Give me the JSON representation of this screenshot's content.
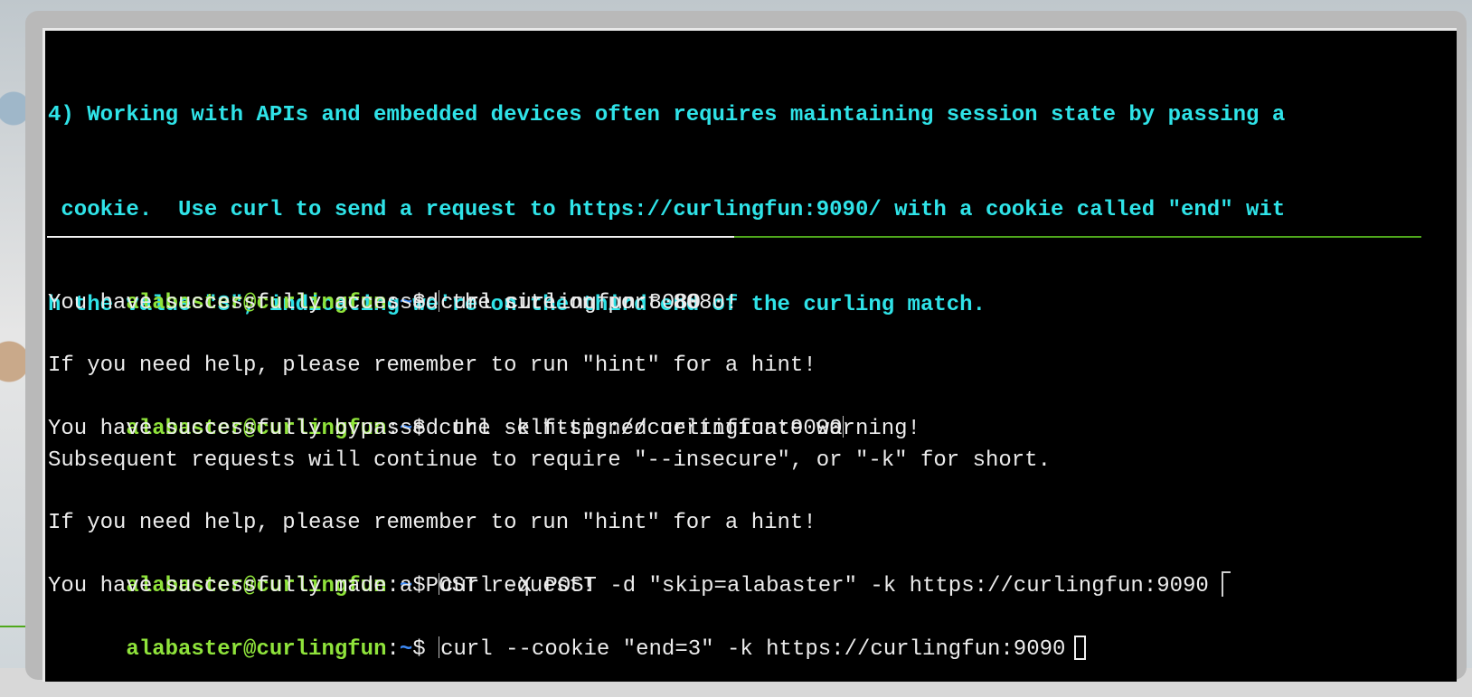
{
  "objective": {
    "lines": [
      "4) Working with APIs and embedded devices often requires maintaining session state by passing a",
      " cookie.  Use curl to send a request to https://curlingfun:9090/ with a cookie called \"end\" wit",
      "h the value \"3\", indicating we're on the third end of the curling match."
    ]
  },
  "prompt": {
    "user_host": "alabaster@curlingfun",
    "separator": ":",
    "path": "~",
    "symbol": "$ "
  },
  "terminal": {
    "lines": [
      {
        "type": "prompt",
        "command": "curl curlingfun:8080"
      },
      {
        "type": "output",
        "text": "You have successfully accessed the site on port 8080!"
      },
      {
        "type": "output",
        "text": ""
      },
      {
        "type": "output",
        "text": "If you need help, please remember to run \"hint\" for a hint!"
      },
      {
        "type": "prompt",
        "command": "curl -k https://curlingfun:9090"
      },
      {
        "type": "output",
        "text": "You have successfully bypassed the self-signed certificate warning!"
      },
      {
        "type": "output",
        "text": "Subsequent requests will continue to require \"--insecure\", or \"-k\" for short."
      },
      {
        "type": "output",
        "text": ""
      },
      {
        "type": "output",
        "text": "If you need help, please remember to run \"hint\" for a hint!"
      },
      {
        "type": "prompt",
        "command": "curl -X POST -d \"skip=alabaster\" -k https://curlingfun:9090"
      },
      {
        "type": "output",
        "text": "You have successfully made a POST request!"
      },
      {
        "type": "prompt",
        "command": "curl --cookie \"end=3\" -k https://curlingfun:9090"
      }
    ]
  },
  "colors": {
    "objective_text": "#2fe3e8",
    "prompt_user": "#8fe33b",
    "prompt_path": "#3d89f5",
    "terminal_bg": "#000000"
  }
}
